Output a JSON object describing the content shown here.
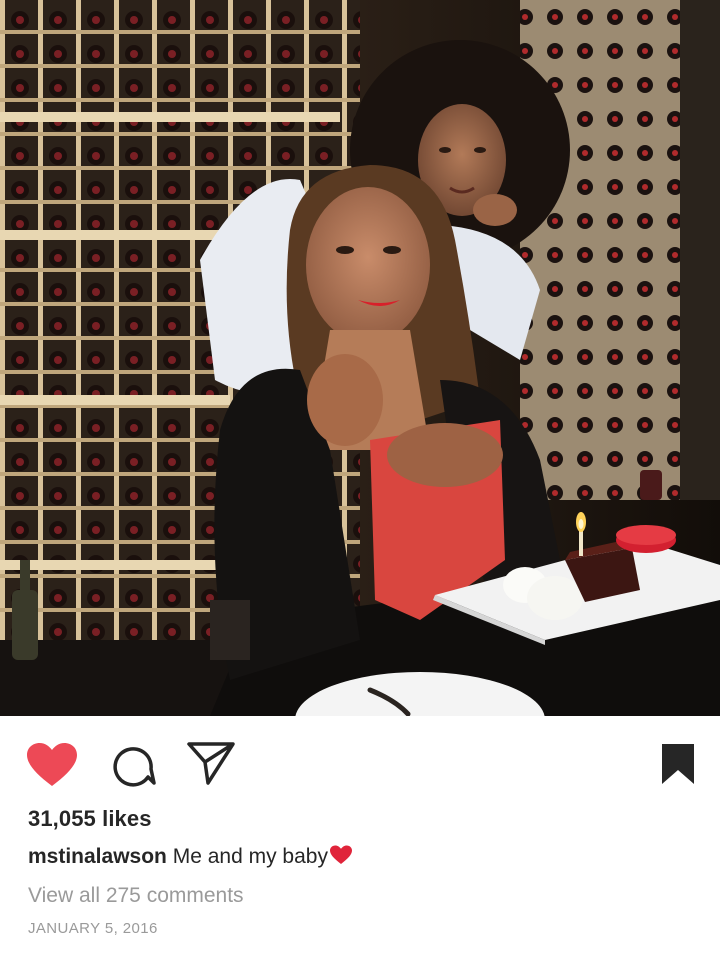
{
  "post": {
    "likes": "31,055 likes",
    "username": "mstinalawson",
    "caption": "Me and my baby",
    "view_comments": "View all 275 comments",
    "date": "JANUARY 5, 2016"
  },
  "icons": {
    "like": "heart-filled-icon",
    "comment": "comment-bubble-icon",
    "share": "paper-plane-icon",
    "save": "bookmark-filled-icon",
    "caption_emoji": "red-heart-emoji-icon"
  },
  "colors": {
    "like_active": "#ed4956",
    "text_primary": "#262626",
    "text_secondary": "#9a9a9a"
  }
}
